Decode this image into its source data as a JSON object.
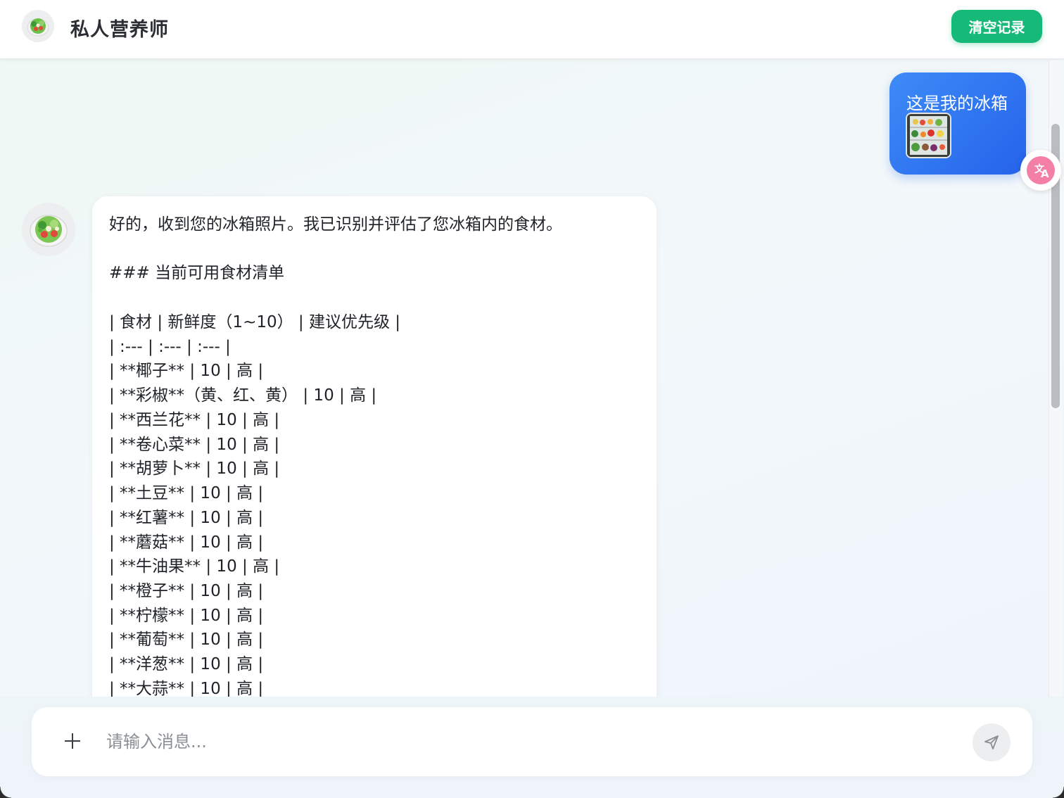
{
  "header": {
    "title": "私人营养师",
    "clear_label": "清空记录"
  },
  "user_message": {
    "text": "这是我的冰箱"
  },
  "bot_message": {
    "lines": [
      "好的，收到您的冰箱照片。我已识别并评估了您冰箱内的食材。",
      "",
      "### 当前可用食材清单",
      "",
      "| 食材 | 新鲜度（1~10） | 建议优先级 |",
      "| :--- | :--- | :--- |",
      "| **椰子** | 10 | 高 |",
      "| **彩椒**（黄、红、黄） | 10 | 高 |",
      "| **西兰花** | 10 | 高 |",
      "| **卷心菜** | 10 | 高 |",
      "| **胡萝卜** | 10 | 高 |",
      "| **土豆** | 10 | 高 |",
      "| **红薯** | 10 | 高 |",
      "| **蘑菇** | 10 | 高 |",
      "| **牛油果** | 10 | 高 |",
      "| **橙子** | 10 | 高 |",
      "| **柠檬** | 10 | 高 |",
      "| **葡萄** | 10 | 高 |",
      "| **洋葱** | 10 | 高 |",
      "| **大蒜** | 10 | 高 |"
    ]
  },
  "composer": {
    "placeholder": "请输入消息..."
  },
  "icons": {
    "avatar": "salad-icon",
    "translate": "translate-icon",
    "plus": "plus-icon",
    "send": "send-icon"
  },
  "colors": {
    "accent_green": "#17b978",
    "user_bubble_blue": "#2563eb",
    "translate_pink": "#f47fa6"
  }
}
